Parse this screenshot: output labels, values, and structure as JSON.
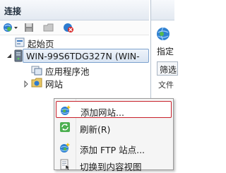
{
  "panel": {
    "title": "连接"
  },
  "toolbar": {
    "icons": [
      "connect-icon",
      "save-icon",
      "folder-icon",
      "disconnect-icon"
    ]
  },
  "tree": {
    "start_page": "起始页",
    "server": "WIN-99S6TDG327N (WIN-",
    "app_pools": "应用程序池",
    "sites": "网站"
  },
  "right_pane": {
    "label_specify": "指定",
    "label_filter": "筛选",
    "label_file": "文件"
  },
  "context_menu": {
    "items": [
      {
        "label": "添加网站...",
        "icon": "globe-add-icon",
        "highlighted": true
      },
      {
        "label": "刷新(R)",
        "icon": "refresh-icon",
        "highlighted": false
      },
      {
        "label": "添加 FTP 站点...",
        "icon": "ftp-globe-icon",
        "highlighted": false
      },
      {
        "label": "切换到内容视图",
        "icon": "content-view-icon",
        "highlighted": false
      }
    ]
  },
  "colors": {
    "highlight_border": "#c8202a",
    "selection_fill": "#d9e4f2",
    "selection_border": "#7da2ce"
  }
}
